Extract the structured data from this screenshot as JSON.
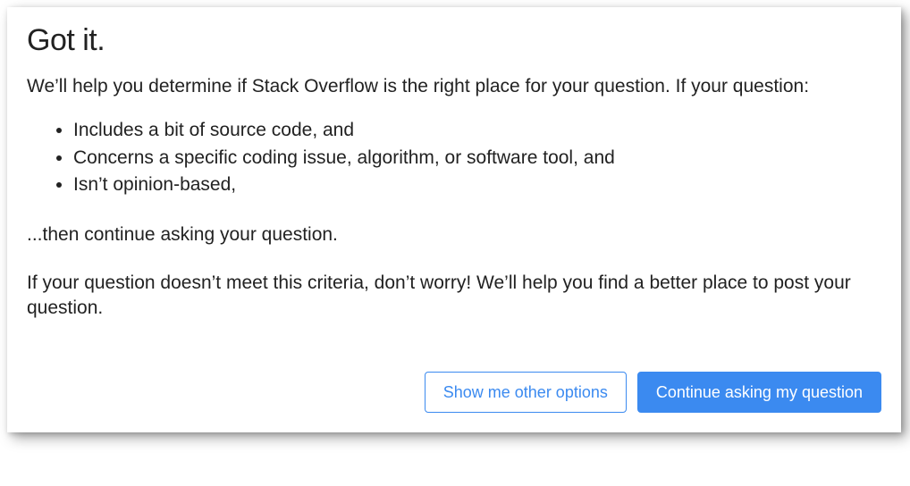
{
  "dialog": {
    "title": "Got it.",
    "intro": "We’ll help you determine if Stack Overflow is the right place for your question. If your question:",
    "criteria": [
      "Includes a bit of source code, and",
      "Concerns a specific coding issue, algorithm, or software tool, and",
      "Isn’t opinion-based,"
    ],
    "continue_text": "...then continue asking your question.",
    "fallback_text": "If your question doesn’t meet this criteria, don’t worry! We’ll help you find a better place to post your question.",
    "buttons": {
      "secondary_label": "Show me other options",
      "primary_label": "Continue asking my question"
    }
  },
  "colors": {
    "accent": "#3b8af0",
    "text": "#222222",
    "background": "#ffffff"
  }
}
